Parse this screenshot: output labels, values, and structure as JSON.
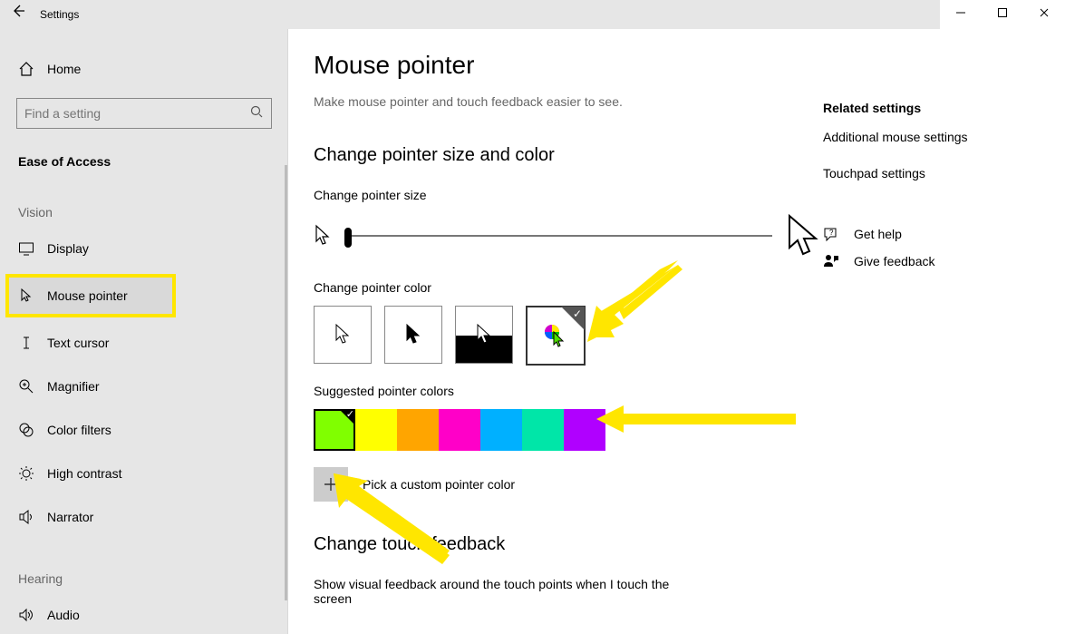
{
  "window": {
    "title": "Settings",
    "minimize": "—",
    "maximize": "▢",
    "close": "✕"
  },
  "sidebar": {
    "home_label": "Home",
    "search_placeholder": "Find a setting",
    "category": "Ease of Access",
    "groups": {
      "vision": "Vision",
      "hearing": "Hearing"
    },
    "items": {
      "display": "Display",
      "mouse_pointer": "Mouse pointer",
      "text_cursor": "Text cursor",
      "magnifier": "Magnifier",
      "color_filters": "Color filters",
      "high_contrast": "High contrast",
      "narrator": "Narrator",
      "audio": "Audio"
    }
  },
  "main": {
    "title": "Mouse pointer",
    "subtitle": "Make mouse pointer and touch feedback easier to see.",
    "section_size_color": "Change pointer size and color",
    "change_size_label": "Change pointer size",
    "change_color_label": "Change pointer color",
    "suggested_label": "Suggested pointer colors",
    "suggested_colors": [
      "#80ff00",
      "#ffff00",
      "#ffa500",
      "#ff00c8",
      "#00b0ff",
      "#00e6a8",
      "#b000ff"
    ],
    "selected_suggested_index": 0,
    "custom_label": "Pick a custom pointer color",
    "section_touch": "Change touch feedback",
    "touch_desc": "Show visual feedback around the touch points when I touch the screen"
  },
  "right": {
    "heading": "Related settings",
    "link_mouse": "Additional mouse settings",
    "link_touchpad": "Touchpad settings",
    "get_help": "Get help",
    "give_feedback": "Give feedback"
  }
}
